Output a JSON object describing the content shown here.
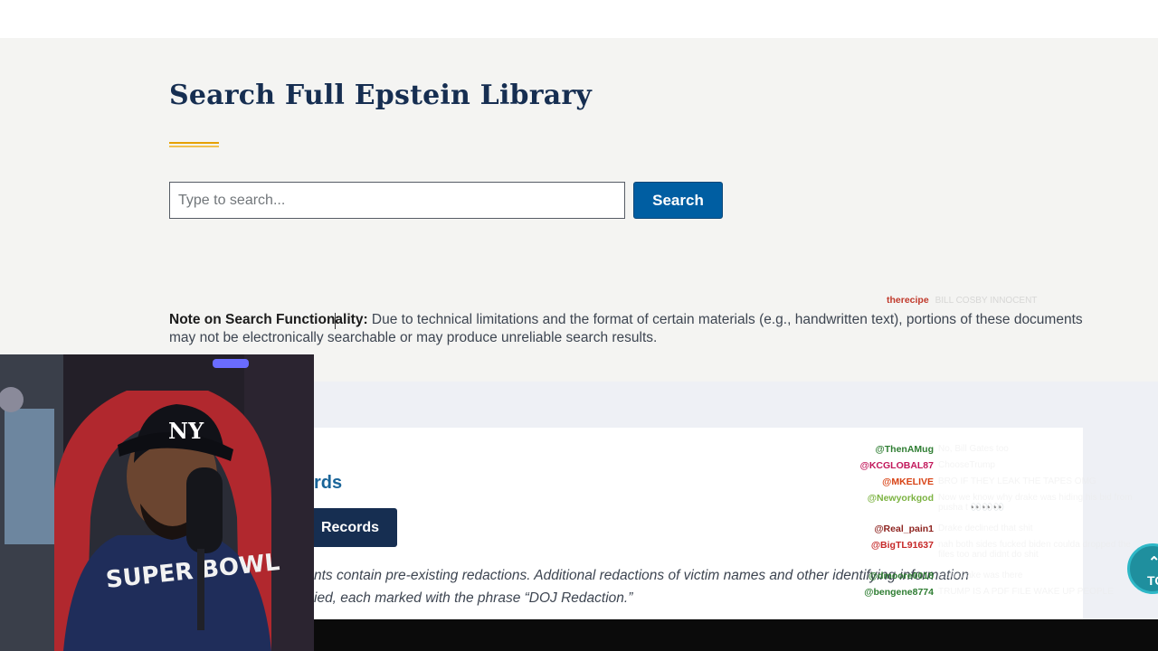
{
  "library": {
    "title": "Search Full Epstein Library",
    "search_placeholder": "Type to search...",
    "search_button": "Search",
    "note_label": "Note on Search Functionality:",
    "note_text": " Due to technical limitations and the format of certain materials (e.g., handwritten text), portions of these documents may not be electronically searchable or may produce unreliable search results."
  },
  "records": {
    "heading_fragment": "rds",
    "button_fragment": "Records",
    "text_line1": "nts contain pre-existing redactions. Additional redactions of victim names and other identifying information",
    "text_line2": "ied, each marked with the phrase “DOJ Redaction.”"
  },
  "back_to_top": {
    "label": "TO"
  },
  "chat_overlay": {
    "top": {
      "user": "therecipe",
      "message": "BILL COSBY INNOCENT",
      "color": "#c0392b"
    },
    "messages": [
      {
        "user": "@ThenAMug",
        "message": "No, Bill Gates too",
        "color": "#2e7d32"
      },
      {
        "user": "@KCGLOBAL87",
        "message": "ChooseTrump",
        "color": "#c2185b"
      },
      {
        "user": "@MKELIVE",
        "message": "BRO IF THEY LEAK THE TAPES OMG",
        "color": "#d84315"
      },
      {
        "user": "@Newyorkgod",
        "message": "Now we know why drake was hiding his bid from pusha t 👀👀👀",
        "color": "#7cb342"
      },
      {
        "user": "@Real_pain1",
        "message": "Drake declined that shit",
        "color": "#8e2420"
      },
      {
        "user": "@BigTL91637",
        "message": "nah both sides fucked biden coulda dropped the files too and didnt do shit",
        "color": "#c62828"
      },
      {
        "user": "@dmoore0018",
        "message": "tired drake was there",
        "color": "#2e7d32"
      },
      {
        "user": "@bengene8774",
        "message": "TRUMP IS A PDF FILE WAKE UP PEOPLE",
        "color": "#2e7d32"
      }
    ]
  },
  "colors": {
    "title": "#162e51",
    "accent": "#e5a000",
    "primary_button": "#005ea2",
    "records_button": "#162e51"
  }
}
